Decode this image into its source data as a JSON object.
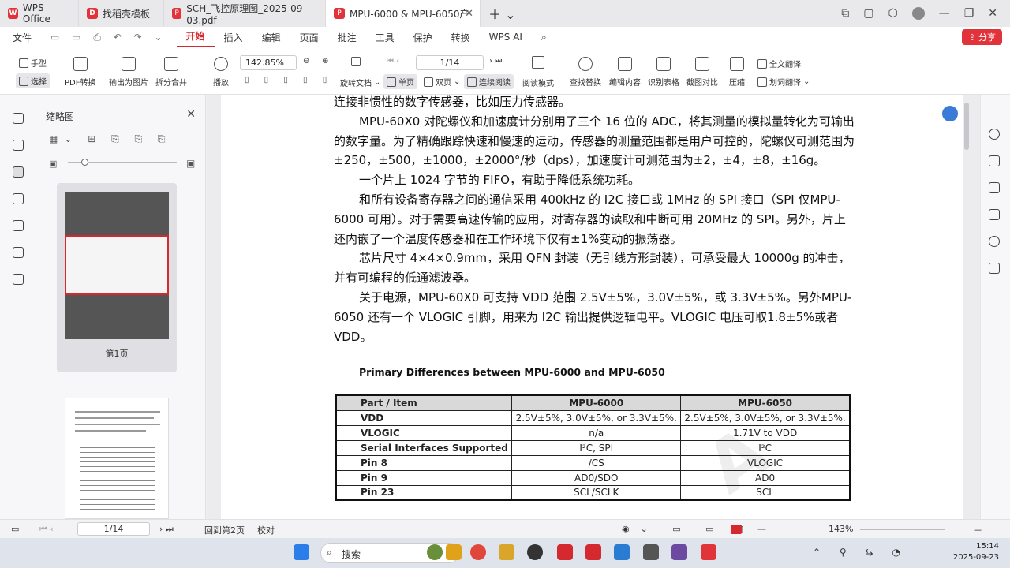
{
  "tabs": [
    {
      "label": "WPS Office"
    },
    {
      "label": "找稻壳模板"
    },
    {
      "label": "SCH_飞控原理图_2025-09-03.pdf"
    },
    {
      "label": "MPU-6000 & MPU-6050产"
    }
  ],
  "menu": {
    "file": "文件",
    "items": [
      "开始",
      "插入",
      "编辑",
      "页面",
      "批注",
      "工具",
      "保护",
      "转换",
      "WPS AI"
    ],
    "active": "开始",
    "share": "分享"
  },
  "toolbar": {
    "hand": "手型",
    "select": "选择",
    "pdf_convert": "PDF转换",
    "to_image": "输出为图片",
    "split_merge": "拆分合并",
    "play": "播放",
    "zoom": "142.85%",
    "page": "1/14",
    "rotate": "旋转文档",
    "single": "单页",
    "double": "双页",
    "continuous": "连续阅读",
    "read_mode": "阅读模式",
    "find_replace": "查找替换",
    "edit_content": "编辑内容",
    "recognize_table": "识别表格",
    "screenshot_compare": "截图对比",
    "compress": "压缩",
    "full_translate": "全文翻译",
    "word_translate": "划词翻译"
  },
  "thumbnails": {
    "title": "缩略图",
    "page1_label": "第1页"
  },
  "document": {
    "paragraphs": [
      {
        "text": "连接非惯性的数字传感器，比如压力传感器。",
        "indent": false
      },
      {
        "text": "MPU-60X0 对陀螺仪和加速度计分别用了三个 16 位的 ADC，将其测量的模拟量转化为可输出的数字量。为了精确跟踪快速和慢速的运动，传感器的测量范围都是用户可控的，陀螺仪可测范围为±250，±500，±1000，±2000°/秒（dps），加速度计可测范围为±2，±4，±8，±16g。",
        "indent": true
      },
      {
        "text": "一个片上 1024 字节的 FIFO，有助于降低系统功耗。",
        "indent": true
      },
      {
        "text": "和所有设备寄存器之间的通信采用 400kHz 的 I2C 接口或 1MHz 的 SPI 接口（SPI 仅MPU-6000 可用）。对于需要高速传输的应用，对寄存器的读取和中断可用 20MHz 的 SPI。另外，片上还内嵌了一个温度传感器和在工作环境下仅有±1%变动的振荡器。",
        "indent": true
      },
      {
        "text": "芯片尺寸 4×4×0.9mm，采用 QFN 封装（无引线方形封装），可承受最大 10000g 的冲击，并有可编程的低通滤波器。",
        "indent": true
      },
      {
        "text": "关于电源，MPU-60X0 可支持 VDD 范围 2.5V±5%，3.0V±5%，或 3.3V±5%。另外MPU-6050 还有一个 VLOGIC 引脚，用来为 I2C 输出提供逻辑电平。VLOGIC 电压可取1.8±5%或者 VDD。",
        "indent": true
      }
    ],
    "table_caption": "Primary Differences between MPU-6000 and MPU-6050",
    "table": {
      "headers": [
        "Part / Item",
        "MPU-6000",
        "MPU-6050"
      ],
      "rows": [
        [
          "VDD",
          "2.5V±5%, 3.0V±5%, or 3.3V±5%.",
          "2.5V±5%, 3.0V±5%, or 3.3V±5%."
        ],
        [
          "VLOGIC",
          "n/a",
          "1.71V to VDD"
        ],
        [
          "Serial Interfaces Supported",
          "I²C, SPI",
          "I²C"
        ],
        [
          "Pin 8",
          "/CS",
          "VLOGIC"
        ],
        [
          "Pin 9",
          "AD0/SDO",
          "AD0"
        ],
        [
          "Pin 23",
          "SCL/SCLK",
          "SCL"
        ]
      ]
    }
  },
  "statusbar": {
    "page": "1/14",
    "back": "回到第2页",
    "proof": "校对",
    "zoom": "143%"
  },
  "taskbar": {
    "search": "搜索",
    "time": "15:14",
    "date": "2025-09-23"
  },
  "colors": {
    "accent": "#d3292f",
    "taskbar": "#dfe4ec"
  }
}
